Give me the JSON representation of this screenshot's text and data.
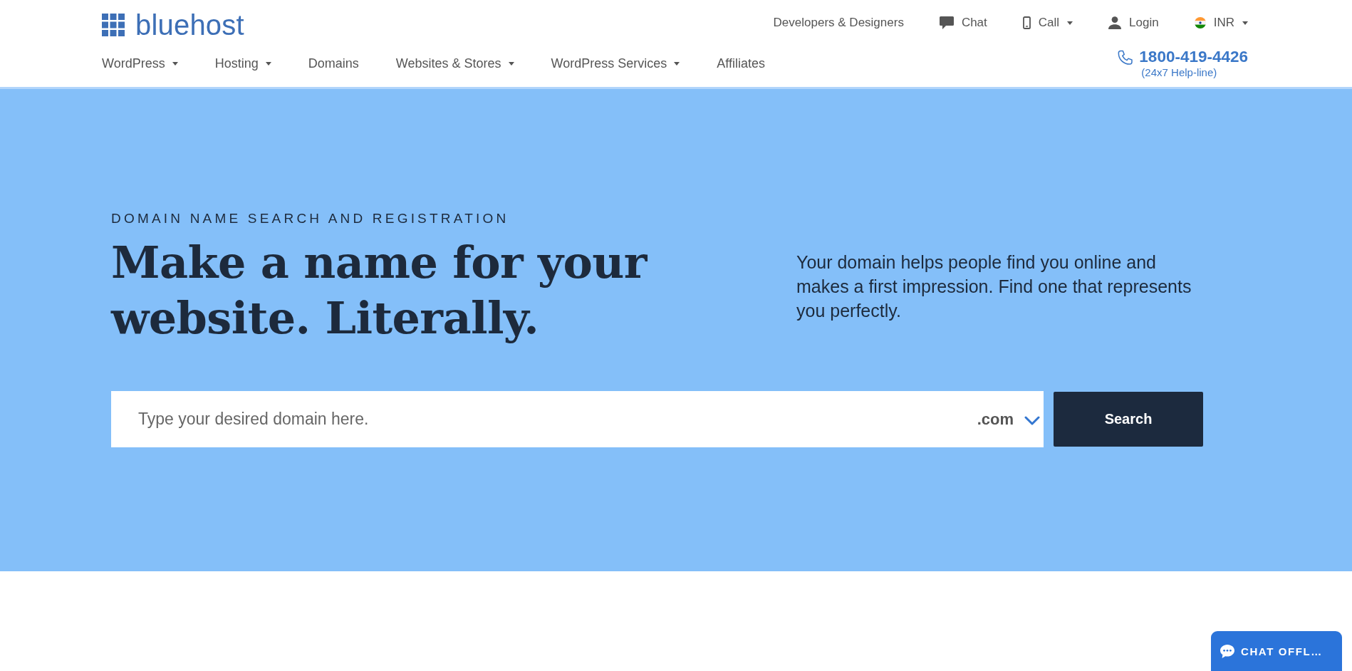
{
  "header": {
    "logo": {
      "text": "bluehost"
    },
    "nav": [
      {
        "label": "WordPress",
        "dropdown": true
      },
      {
        "label": "Hosting",
        "dropdown": true
      },
      {
        "label": "Domains",
        "dropdown": false
      },
      {
        "label": "Websites & Stores",
        "dropdown": true
      },
      {
        "label": "WordPress Services",
        "dropdown": true
      },
      {
        "label": "Affiliates",
        "dropdown": false
      }
    ],
    "top_links": [
      {
        "label": "Developers & Designers",
        "kind": "plain",
        "dropdown": false
      },
      {
        "label": "Chat",
        "kind": "chat",
        "dropdown": false
      },
      {
        "label": "Call",
        "kind": "call",
        "dropdown": true
      },
      {
        "label": "Login",
        "kind": "account",
        "dropdown": false
      },
      {
        "label": "INR",
        "kind": "currency",
        "dropdown": true
      }
    ],
    "helpline": {
      "number": "1800-419-4426",
      "note": "(24x7 Help-line)"
    }
  },
  "hero": {
    "eyebrow": "DOMAIN NAME SEARCH AND REGISTRATION",
    "headline": "Make a name for your website. Literally.",
    "description": "Your domain helps people find you online and makes a first impression. Find one that represents you perfectly.",
    "search": {
      "placeholder": "Type your desired domain here.",
      "tld": ".com",
      "button": "Search"
    }
  },
  "chat_widget": {
    "label": "CHAT OFFL…"
  }
}
